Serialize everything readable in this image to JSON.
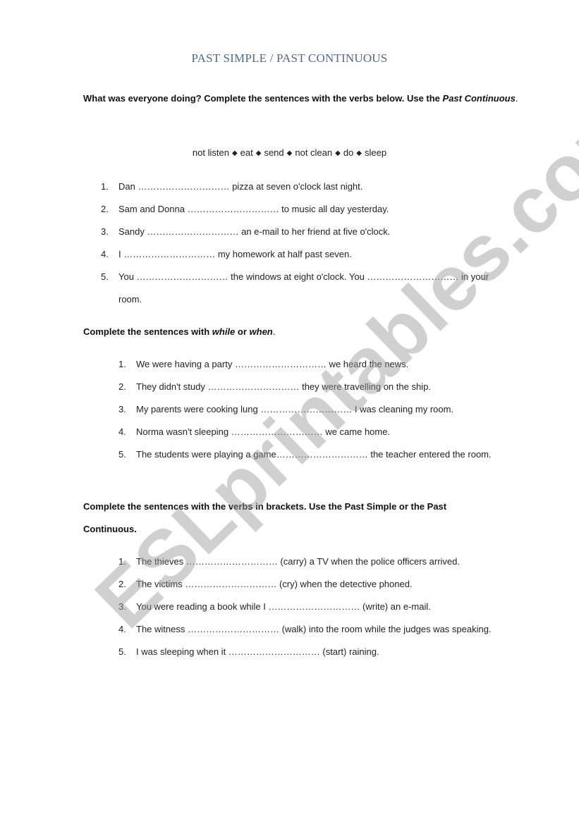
{
  "title": "PAST SIMPLE / PAST CONTINUOUS",
  "watermark": "ESLprintables.com",
  "section1": {
    "instruction_main": "What was everyone doing? Complete the sentences with the verbs below. Use the ",
    "instruction_italic": "Past Continuous",
    "instruction_end": ".",
    "word_bank": [
      "not listen",
      "eat",
      "send",
      "not clean",
      "do",
      "sleep"
    ],
    "word_separator": "◆",
    "items": [
      {
        "num": "1.",
        "text": "Dan ………………………… pizza at seven o'clock last night."
      },
      {
        "num": "2.",
        "text": "Sam and Donna ………………………… to music all day yesterday."
      },
      {
        "num": "3.",
        "text": "Sandy ………………………… an e-mail to her friend at five o'clock."
      },
      {
        "num": "4.",
        "text": "I ………………………… my homework at half past seven."
      },
      {
        "num": "5.",
        "text": "You ………………………… the windows at eight o'clock. You ………………………… in your",
        "continuation": "room."
      }
    ]
  },
  "section2": {
    "instruction_start": "Complete the sentences with ",
    "instruction_while": "while",
    "instruction_or": " or ",
    "instruction_when": "when",
    "instruction_end": ".",
    "items": [
      {
        "num": "1.",
        "text": "We were having a party ………………………… we heard the news."
      },
      {
        "num": "2.",
        "text": "They didn't study ………………………… they were travelling on the ship."
      },
      {
        "num": "3.",
        "text": "My parents were cooking lung ………………………… I was cleaning my room."
      },
      {
        "num": "4.",
        "text": "Norma wasn't sleeping ………………………… we came home."
      },
      {
        "num": "5.",
        "text": "The students were playing a game………………………… the teacher entered the room."
      }
    ]
  },
  "section3": {
    "instruction_line1": "Complete the sentences with the verbs in brackets. Use the Past Simple or the Past",
    "instruction_line2": "Continuous.",
    "items": [
      {
        "num": "1.",
        "text": "The thieves ………………………… (carry) a TV when the police officers arrived."
      },
      {
        "num": "2.",
        "text": "The victims ………………………… (cry) when the detective phoned."
      },
      {
        "num": "3.",
        "text": "You were reading a book while I ………………………… (write) an e-mail."
      },
      {
        "num": "4.",
        "text": "The witness ………………………… (walk) into the room while the judges was speaking."
      },
      {
        "num": "5.",
        "text": "I was sleeping when it ………………………… (start) raining."
      }
    ]
  }
}
